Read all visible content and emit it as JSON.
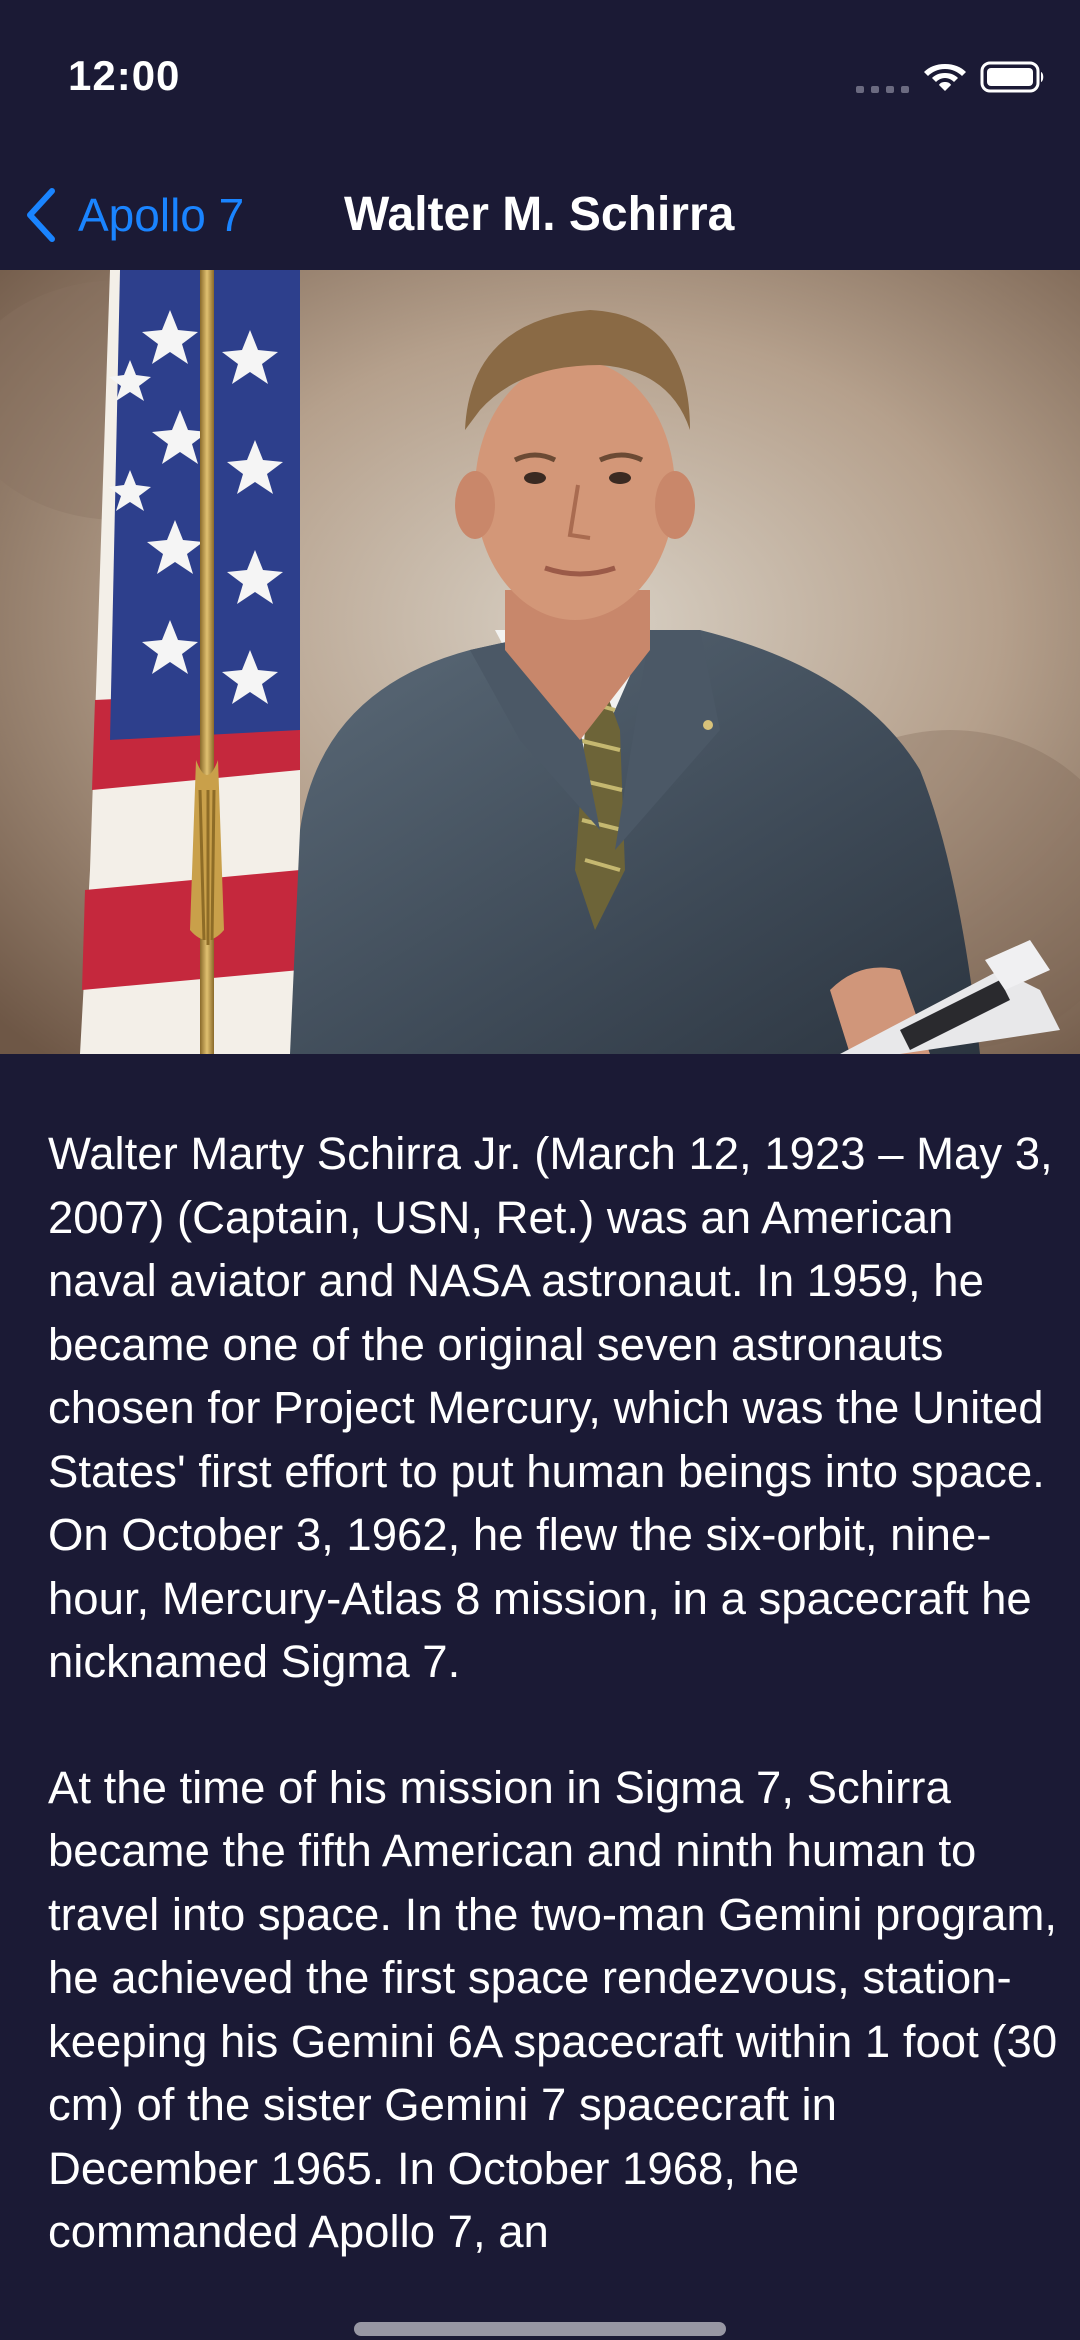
{
  "status_bar": {
    "time": "12:00"
  },
  "nav": {
    "back_label": "Apollo 7",
    "title": "Walter M. Schirra"
  },
  "photo": {
    "subject": "Portrait photograph of Walter M. Schirra in a grey suit beside an American flag"
  },
  "bio": {
    "paragraphs": [
      "Walter Marty Schirra Jr. (March 12, 1923 – May 3, 2007) (Captain, USN, Ret.) was an American naval aviator and NASA astronaut. In 1959, he became one of the original seven astronauts chosen for Project Mercury, which was the United States' first effort to put human beings into space. On October 3, 1962, he flew the six-orbit, nine-hour, Mercury-Atlas 8 mission, in a spacecraft he nicknamed Sigma 7.",
      "At the time of his mission in Sigma 7, Schirra became the fifth American and ninth human to travel into space. In the two-man Gemini program, he achieved the first space rendezvous, station-keeping his Gemini 6A spacecraft within 1 foot (30 cm) of the sister Gemini 7 spacecraft in December 1965. In October 1968, he commanded Apollo 7, an"
    ]
  },
  "colors": {
    "background": "#1b1a35",
    "accent": "#1a84ff",
    "text": "#ffffff"
  },
  "icons": {
    "back": "chevron-left-icon",
    "signal": "cellular-signal-icon",
    "wifi": "wifi-icon",
    "battery": "battery-icon"
  }
}
